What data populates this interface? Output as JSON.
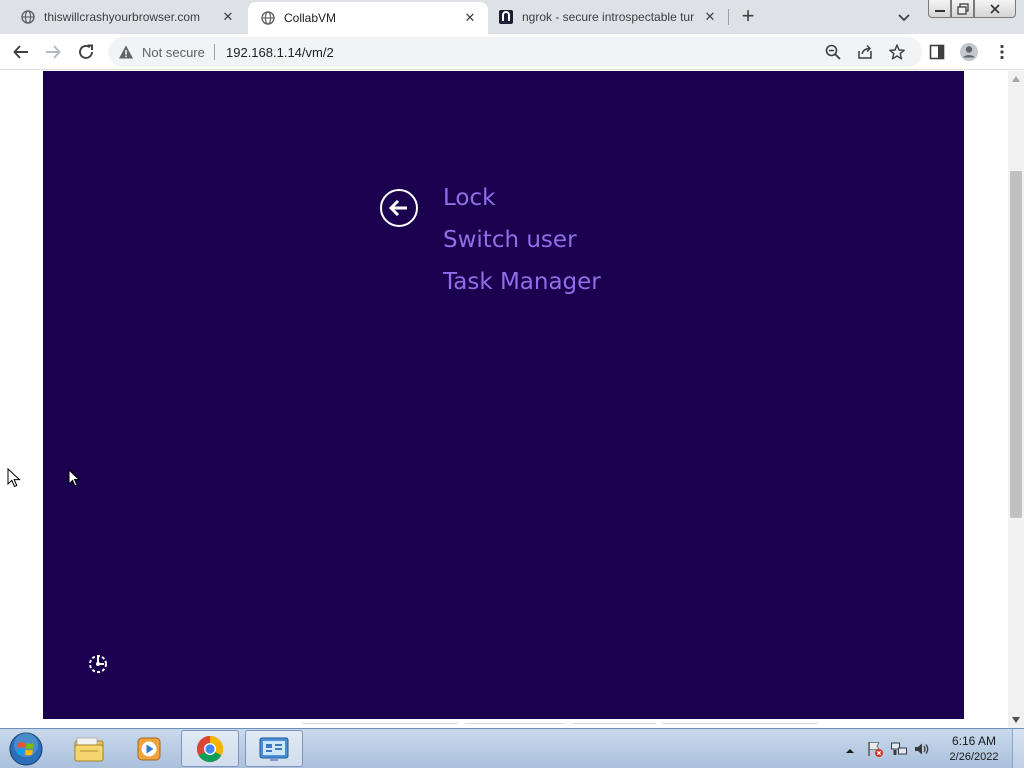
{
  "browser": {
    "tabs": [
      {
        "title": "thiswillcrashyourbrowser.com",
        "active": false
      },
      {
        "title": "CollabVM",
        "active": true
      },
      {
        "title": "ngrok - secure introspectable tur",
        "active": false
      }
    ],
    "address": {
      "security_label": "Not secure",
      "url": "192.168.1.14/vm/2"
    }
  },
  "vm": {
    "menu": {
      "lock": "Lock",
      "switch_user": "Switch user",
      "task_manager": "Task Manager"
    },
    "background_color": "#1b0050",
    "menu_text_color": "#8f6ee8"
  },
  "taskbar": {
    "apps": [
      {
        "icon": "file-explorer-icon"
      },
      {
        "icon": "media-player-icon"
      },
      {
        "icon": "chrome-icon",
        "pressed": true
      },
      {
        "icon": "control-panel-icon",
        "pressed": true
      }
    ],
    "clock": {
      "time": "6:16 AM",
      "date": "2/26/2022"
    }
  }
}
